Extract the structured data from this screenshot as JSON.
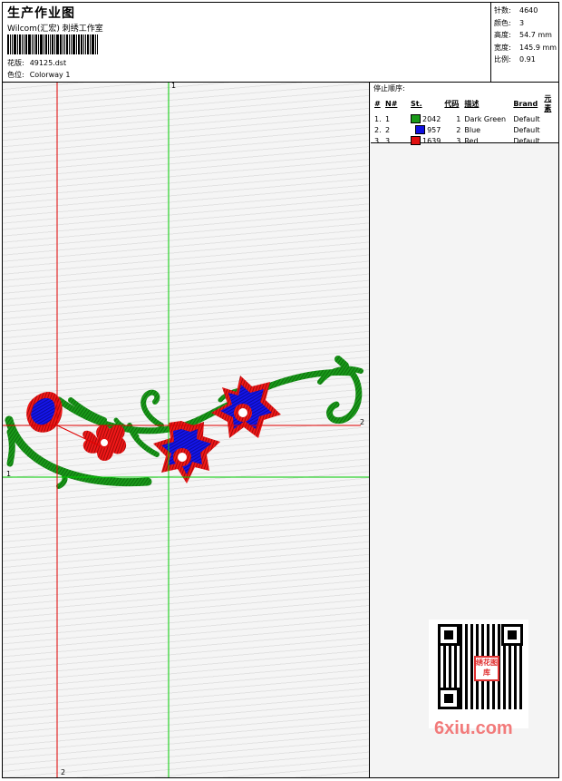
{
  "header": {
    "title": "生产作业图",
    "subtitle": "Wilcom(汇宏) 刺绣工作室",
    "design_label": "花版:",
    "design_value": "49125.dst",
    "colorway_label": "色位:",
    "colorway_value": "Colorway 1"
  },
  "stats": [
    {
      "label": "针数:",
      "value": "4640"
    },
    {
      "label": "颜色:",
      "value": "3"
    },
    {
      "label": "高度:",
      "value": "54.7 mm"
    },
    {
      "label": "宽度:",
      "value": "145.9 mm"
    },
    {
      "label": "比例:",
      "value": "0.91"
    }
  ],
  "stops": {
    "title": "停止顺序:",
    "columns": [
      "#",
      "N#",
      "St.",
      "代码",
      "描述",
      "Brand",
      "元素"
    ],
    "rows": [
      {
        "idx": "1.",
        "n": "1",
        "color": "#1a9a1a",
        "st": "2042",
        "code": "1",
        "desc": "Dark Green",
        "brand": "Default"
      },
      {
        "idx": "2.",
        "n": "2",
        "color": "#1010e0",
        "st": "957",
        "code": "2",
        "desc": "Blue",
        "brand": "Default"
      },
      {
        "idx": "3.",
        "n": "3",
        "color": "#e01010",
        "st": "1639",
        "code": "3",
        "desc": "Red",
        "brand": "Default"
      }
    ]
  },
  "guides": {
    "green_v": "1",
    "green_h": "1",
    "red_h": "2",
    "red_v": "2"
  },
  "watermark": "6xiu.com",
  "qr_stamp": "绣花图库",
  "colors": {
    "green": "#1a9a1a",
    "blue": "#1010e0",
    "red": "#e01010",
    "guide_green": "#00cc00",
    "guide_red": "#e00000"
  }
}
